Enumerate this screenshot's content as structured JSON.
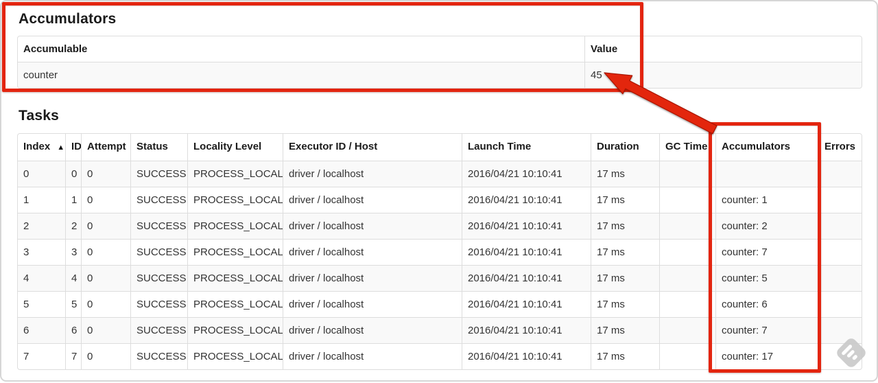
{
  "accumulators_section": {
    "title": "Accumulators",
    "table": {
      "headers": [
        "Accumulable",
        "Value"
      ],
      "rows": [
        [
          "counter",
          "45"
        ]
      ]
    }
  },
  "tasks_section": {
    "title": "Tasks",
    "table": {
      "headers": [
        "Index",
        "ID",
        "Attempt",
        "Status",
        "Locality Level",
        "Executor ID / Host",
        "Launch Time",
        "Duration",
        "GC Time",
        "Accumulators",
        "Errors"
      ],
      "sort": {
        "column": "Index",
        "indicator": "▲"
      },
      "rows": [
        [
          "0",
          "0",
          "0",
          "SUCCESS",
          "PROCESS_LOCAL",
          "driver / localhost",
          "2016/04/21 10:10:41",
          "17 ms",
          "",
          "",
          ""
        ],
        [
          "1",
          "1",
          "0",
          "SUCCESS",
          "PROCESS_LOCAL",
          "driver / localhost",
          "2016/04/21 10:10:41",
          "17 ms",
          "",
          "counter: 1",
          ""
        ],
        [
          "2",
          "2",
          "0",
          "SUCCESS",
          "PROCESS_LOCAL",
          "driver / localhost",
          "2016/04/21 10:10:41",
          "17 ms",
          "",
          "counter: 2",
          ""
        ],
        [
          "3",
          "3",
          "0",
          "SUCCESS",
          "PROCESS_LOCAL",
          "driver / localhost",
          "2016/04/21 10:10:41",
          "17 ms",
          "",
          "counter: 7",
          ""
        ],
        [
          "4",
          "4",
          "0",
          "SUCCESS",
          "PROCESS_LOCAL",
          "driver / localhost",
          "2016/04/21 10:10:41",
          "17 ms",
          "",
          "counter: 5",
          ""
        ],
        [
          "5",
          "5",
          "0",
          "SUCCESS",
          "PROCESS_LOCAL",
          "driver / localhost",
          "2016/04/21 10:10:41",
          "17 ms",
          "",
          "counter: 6",
          ""
        ],
        [
          "6",
          "6",
          "0",
          "SUCCESS",
          "PROCESS_LOCAL",
          "driver / localhost",
          "2016/04/21 10:10:41",
          "17 ms",
          "",
          "counter: 7",
          ""
        ],
        [
          "7",
          "7",
          "0",
          "SUCCESS",
          "PROCESS_LOCAL",
          "driver / localhost",
          "2016/04/21 10:10:41",
          "17 ms",
          "",
          "counter: 17",
          ""
        ]
      ]
    }
  },
  "annotations": {
    "accent_color": "#e3250f"
  }
}
